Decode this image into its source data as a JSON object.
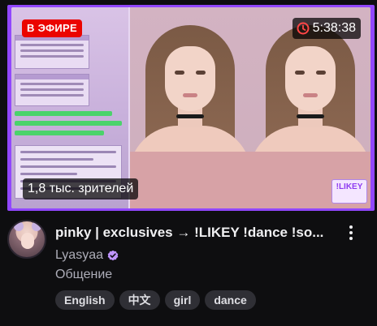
{
  "stream": {
    "live_label": "В ЭФИРЕ",
    "uptime": "5:38:38",
    "viewers": "1,8 тыс. зрителей",
    "title": "pinky | exclusives → !LIKEY !dance !so...",
    "channel": "Lyasyaa",
    "category": "Общение",
    "tags": [
      "English",
      "中文",
      "girl",
      "dance"
    ],
    "thumbnail_logo": "!LIKEY"
  },
  "icons": {
    "uptime": "clock-icon",
    "verified": "verified-badge-icon",
    "more": "more-options-icon"
  },
  "colors": {
    "accent": "#9147ff",
    "live": "#eb0400",
    "background": "#0e0e10",
    "tag_bg": "#2f2f35"
  }
}
